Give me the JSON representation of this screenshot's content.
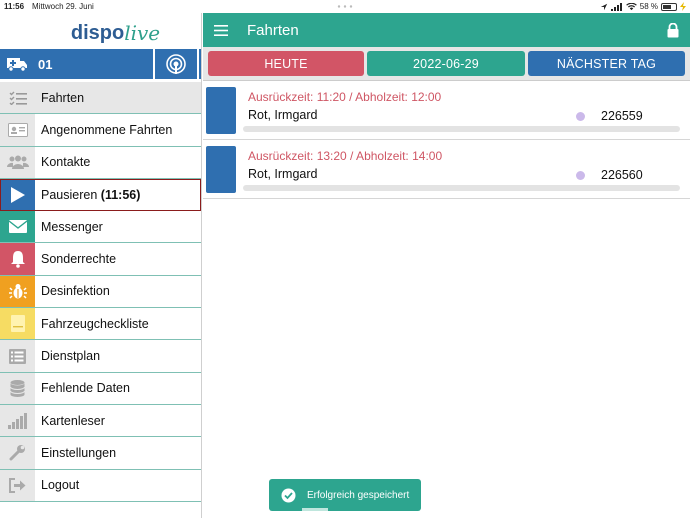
{
  "statusbar": {
    "time": "11:56",
    "date": "Mittwoch 29. Juni",
    "battery": "58 %"
  },
  "logo": {
    "part1": "dispo",
    "part2": "live"
  },
  "vehicle": {
    "number": "01"
  },
  "menu": [
    {
      "label": "Fahrten",
      "icon": "list-check-icon",
      "icon_bg": "#e7e7e7",
      "icon_color": "#888888"
    },
    {
      "label": "Angenommene Fahrten",
      "icon": "id-card-icon",
      "icon_bg": "#e7e7e7",
      "icon_color": "#9a9a9a"
    },
    {
      "label": "Kontakte",
      "icon": "users-icon",
      "icon_bg": "#e7e7e7",
      "icon_color": "#9a9a9a"
    },
    {
      "label": "Pausieren",
      "label_extra": "(11:56)",
      "icon": "play-icon",
      "icon_bg": "#2f6fb0",
      "icon_color": "#ffffff"
    },
    {
      "label": "Messenger",
      "icon": "envelope-icon",
      "icon_bg": "#2da58f",
      "icon_color": "#ffffff"
    },
    {
      "label": "Sonderrechte",
      "icon": "bell-icon",
      "icon_bg": "#d25566",
      "icon_color": "#ffffff"
    },
    {
      "label": "Desinfektion",
      "icon": "bug-icon",
      "icon_bg": "#f0a020",
      "icon_color": "#ffffff"
    },
    {
      "label": "Fahrzeugchecklist e",
      "display": "Fahrzeugcheckliste",
      "icon": "note-icon",
      "icon_bg": "#f6dc63",
      "icon_color": "#fff6cc"
    },
    {
      "label": "Dienstplan",
      "icon": "list-icon",
      "icon_bg": "#e7e7e7",
      "icon_color": "#9a9a9a"
    },
    {
      "label": "Fehlende Daten",
      "icon": "database-icon",
      "icon_bg": "#e7e7e7",
      "icon_color": "#9a9a9a"
    },
    {
      "label": "Kartenleser",
      "icon": "signal-bars-icon",
      "icon_bg": "#e7e7e7",
      "icon_color": "#9a9a9a"
    },
    {
      "label": "Einstellungen",
      "icon": "wrench-icon",
      "icon_bg": "#e7e7e7",
      "icon_color": "#9a9a9a"
    },
    {
      "label": "Logout",
      "icon": "logout-icon",
      "icon_bg": "#e7e7e7",
      "icon_color": "#9a9a9a"
    }
  ],
  "appbar": {
    "title": "Fahrten"
  },
  "tabs": {
    "today": "HEUTE",
    "date": "2022-06-29",
    "next": "NÄCHSTER TAG"
  },
  "trips": [
    {
      "times": "Ausrückzeit: 11:20 / Abholzeit: 12:00",
      "name": "Rot, Irmgard",
      "number": "226559"
    },
    {
      "times": "Ausrückzeit: 13:20 / Abholzeit: 14:00",
      "name": "Rot, Irmgard",
      "number": "226560"
    }
  ],
  "toast": {
    "message": "Erfolgreich gespeichert"
  },
  "colors": {
    "teal": "#2da58f",
    "blue": "#2f6fb0",
    "red": "#d25566"
  }
}
